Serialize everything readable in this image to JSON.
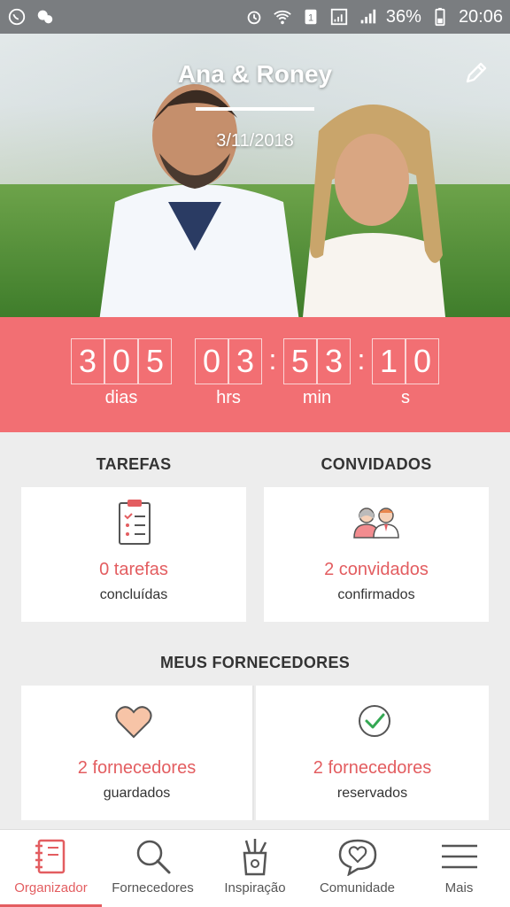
{
  "status_bar": {
    "battery": "36%",
    "time": "20:06"
  },
  "hero": {
    "couple_name": "Ana & Roney",
    "date": "3/11/2018"
  },
  "countdown": {
    "days_digits": [
      "3",
      "0",
      "5"
    ],
    "hours_digits": [
      "0",
      "3"
    ],
    "minutes_digits": [
      "5",
      "3"
    ],
    "seconds_digits": [
      "1",
      "0"
    ],
    "days_label": "dias",
    "hours_label": "hrs",
    "minutes_label": "min",
    "seconds_label": "s"
  },
  "tasks": {
    "title": "TAREFAS",
    "value": "0 tarefas",
    "sub": "concluídas"
  },
  "guests": {
    "title": "CONVIDADOS",
    "value": "2 convidados",
    "sub": "confirmados"
  },
  "vendors": {
    "title": "MEUS FORNECEDORES",
    "saved_value": "2 fornecedores",
    "saved_sub": "guardados",
    "booked_value": "2 fornecedores",
    "booked_sub": "reservados"
  },
  "nav": {
    "items": [
      {
        "label": "Organizador",
        "icon": "notebook-icon"
      },
      {
        "label": "Fornecedores",
        "icon": "search-icon"
      },
      {
        "label": "Inspiração",
        "icon": "pencil-cup-icon"
      },
      {
        "label": "Comunidade",
        "icon": "heart-chat-icon"
      },
      {
        "label": "Mais",
        "icon": "menu-icon"
      }
    ],
    "active_index": 0
  },
  "colors": {
    "accent": "#f26f73",
    "accent_text": "#e35d60",
    "statusbar": "#7a7d80"
  }
}
